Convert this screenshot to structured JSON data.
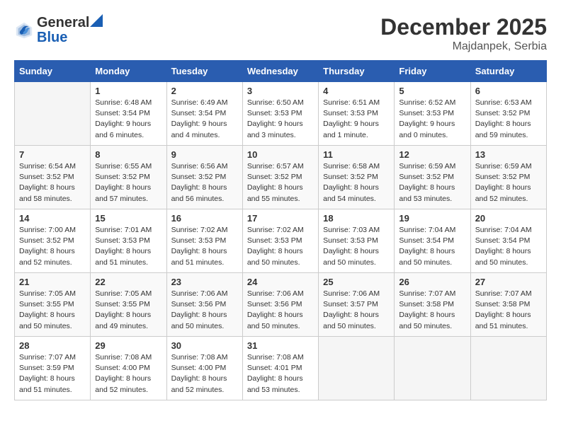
{
  "logo": {
    "line1": "General",
    "line2": "Blue"
  },
  "title": "December 2025",
  "location": "Majdanpek, Serbia",
  "headers": [
    "Sunday",
    "Monday",
    "Tuesday",
    "Wednesday",
    "Thursday",
    "Friday",
    "Saturday"
  ],
  "weeks": [
    [
      {
        "day": "",
        "info": ""
      },
      {
        "day": "1",
        "info": "Sunrise: 6:48 AM\nSunset: 3:54 PM\nDaylight: 9 hours\nand 6 minutes."
      },
      {
        "day": "2",
        "info": "Sunrise: 6:49 AM\nSunset: 3:54 PM\nDaylight: 9 hours\nand 4 minutes."
      },
      {
        "day": "3",
        "info": "Sunrise: 6:50 AM\nSunset: 3:53 PM\nDaylight: 9 hours\nand 3 minutes."
      },
      {
        "day": "4",
        "info": "Sunrise: 6:51 AM\nSunset: 3:53 PM\nDaylight: 9 hours\nand 1 minute."
      },
      {
        "day": "5",
        "info": "Sunrise: 6:52 AM\nSunset: 3:53 PM\nDaylight: 9 hours\nand 0 minutes."
      },
      {
        "day": "6",
        "info": "Sunrise: 6:53 AM\nSunset: 3:52 PM\nDaylight: 8 hours\nand 59 minutes."
      }
    ],
    [
      {
        "day": "7",
        "info": "Sunrise: 6:54 AM\nSunset: 3:52 PM\nDaylight: 8 hours\nand 58 minutes."
      },
      {
        "day": "8",
        "info": "Sunrise: 6:55 AM\nSunset: 3:52 PM\nDaylight: 8 hours\nand 57 minutes."
      },
      {
        "day": "9",
        "info": "Sunrise: 6:56 AM\nSunset: 3:52 PM\nDaylight: 8 hours\nand 56 minutes."
      },
      {
        "day": "10",
        "info": "Sunrise: 6:57 AM\nSunset: 3:52 PM\nDaylight: 8 hours\nand 55 minutes."
      },
      {
        "day": "11",
        "info": "Sunrise: 6:58 AM\nSunset: 3:52 PM\nDaylight: 8 hours\nand 54 minutes."
      },
      {
        "day": "12",
        "info": "Sunrise: 6:59 AM\nSunset: 3:52 PM\nDaylight: 8 hours\nand 53 minutes."
      },
      {
        "day": "13",
        "info": "Sunrise: 6:59 AM\nSunset: 3:52 PM\nDaylight: 8 hours\nand 52 minutes."
      }
    ],
    [
      {
        "day": "14",
        "info": "Sunrise: 7:00 AM\nSunset: 3:52 PM\nDaylight: 8 hours\nand 52 minutes."
      },
      {
        "day": "15",
        "info": "Sunrise: 7:01 AM\nSunset: 3:53 PM\nDaylight: 8 hours\nand 51 minutes."
      },
      {
        "day": "16",
        "info": "Sunrise: 7:02 AM\nSunset: 3:53 PM\nDaylight: 8 hours\nand 51 minutes."
      },
      {
        "day": "17",
        "info": "Sunrise: 7:02 AM\nSunset: 3:53 PM\nDaylight: 8 hours\nand 50 minutes."
      },
      {
        "day": "18",
        "info": "Sunrise: 7:03 AM\nSunset: 3:53 PM\nDaylight: 8 hours\nand 50 minutes."
      },
      {
        "day": "19",
        "info": "Sunrise: 7:04 AM\nSunset: 3:54 PM\nDaylight: 8 hours\nand 50 minutes."
      },
      {
        "day": "20",
        "info": "Sunrise: 7:04 AM\nSunset: 3:54 PM\nDaylight: 8 hours\nand 50 minutes."
      }
    ],
    [
      {
        "day": "21",
        "info": "Sunrise: 7:05 AM\nSunset: 3:55 PM\nDaylight: 8 hours\nand 50 minutes."
      },
      {
        "day": "22",
        "info": "Sunrise: 7:05 AM\nSunset: 3:55 PM\nDaylight: 8 hours\nand 49 minutes."
      },
      {
        "day": "23",
        "info": "Sunrise: 7:06 AM\nSunset: 3:56 PM\nDaylight: 8 hours\nand 50 minutes."
      },
      {
        "day": "24",
        "info": "Sunrise: 7:06 AM\nSunset: 3:56 PM\nDaylight: 8 hours\nand 50 minutes."
      },
      {
        "day": "25",
        "info": "Sunrise: 7:06 AM\nSunset: 3:57 PM\nDaylight: 8 hours\nand 50 minutes."
      },
      {
        "day": "26",
        "info": "Sunrise: 7:07 AM\nSunset: 3:58 PM\nDaylight: 8 hours\nand 50 minutes."
      },
      {
        "day": "27",
        "info": "Sunrise: 7:07 AM\nSunset: 3:58 PM\nDaylight: 8 hours\nand 51 minutes."
      }
    ],
    [
      {
        "day": "28",
        "info": "Sunrise: 7:07 AM\nSunset: 3:59 PM\nDaylight: 8 hours\nand 51 minutes."
      },
      {
        "day": "29",
        "info": "Sunrise: 7:08 AM\nSunset: 4:00 PM\nDaylight: 8 hours\nand 52 minutes."
      },
      {
        "day": "30",
        "info": "Sunrise: 7:08 AM\nSunset: 4:00 PM\nDaylight: 8 hours\nand 52 minutes."
      },
      {
        "day": "31",
        "info": "Sunrise: 7:08 AM\nSunset: 4:01 PM\nDaylight: 8 hours\nand 53 minutes."
      },
      {
        "day": "",
        "info": ""
      },
      {
        "day": "",
        "info": ""
      },
      {
        "day": "",
        "info": ""
      }
    ]
  ]
}
